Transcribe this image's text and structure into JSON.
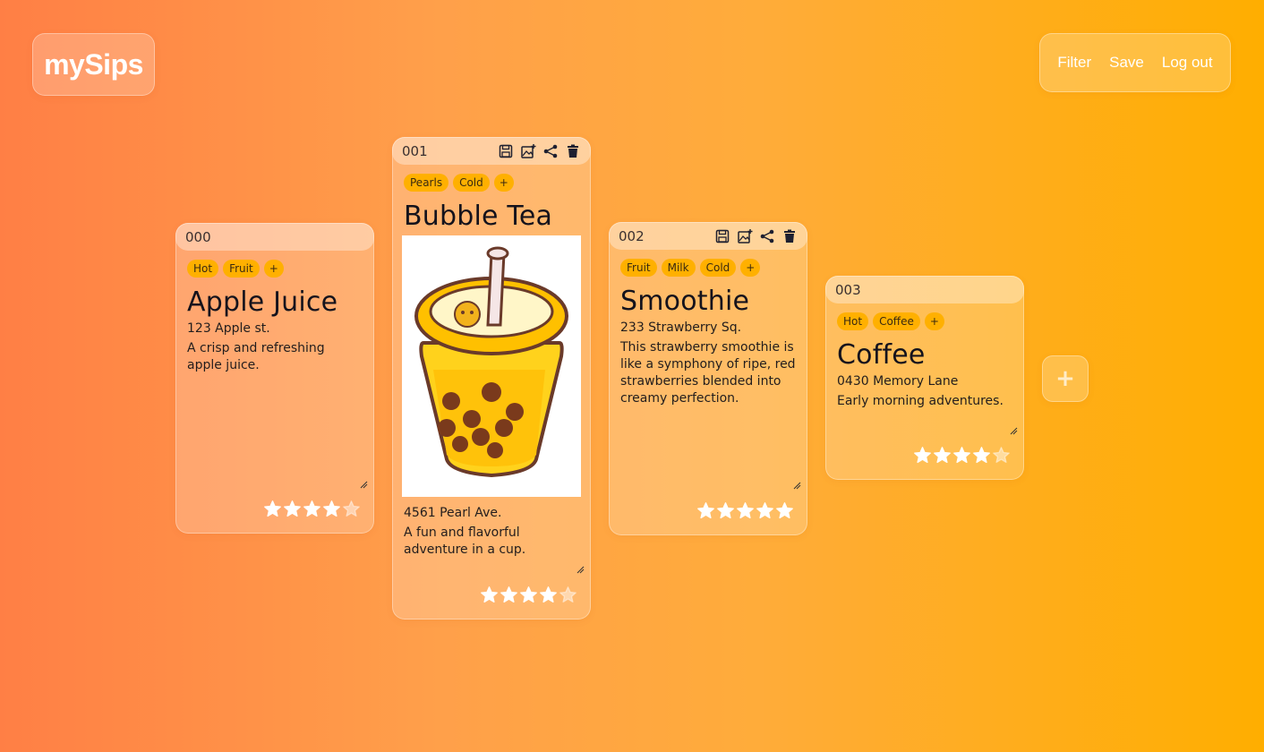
{
  "app": {
    "logo": "mySips"
  },
  "nav": {
    "filter": "Filter",
    "save": "Save",
    "logout": "Log out"
  },
  "add_button": "+",
  "cards": [
    {
      "id": "000",
      "tags": [
        "Hot",
        "Fruit"
      ],
      "add_tag": "+",
      "title": "Apple Juice",
      "address": "123 Apple st.",
      "description": "A crisp and refreshing apple juice.",
      "rating": 4,
      "max_rating": 5,
      "show_actions": false
    },
    {
      "id": "001",
      "tags": [
        "Pearls",
        "Cold"
      ],
      "add_tag": "+",
      "title": "Bubble Tea",
      "address": "4561 Pearl Ave.",
      "description": "A fun and flavorful adventure in a cup.",
      "rating": 4,
      "max_rating": 5,
      "show_actions": true
    },
    {
      "id": "002",
      "tags": [
        "Fruit",
        "Milk",
        "Cold"
      ],
      "add_tag": "+",
      "title": "Smoothie",
      "address": "233 Strawberry Sq.",
      "description": "This strawberry smoothie is like a symphony of ripe, red strawberries blended into creamy perfection.",
      "rating": 5,
      "max_rating": 5,
      "show_actions": true
    },
    {
      "id": "003",
      "tags": [
        "Hot",
        "Coffee"
      ],
      "add_tag": "+",
      "title": "Coffee",
      "address": "0430 Memory Lane",
      "description": "Early morning adventures.",
      "rating": 4,
      "max_rating": 5,
      "show_actions": false
    }
  ],
  "icons": [
    "save-icon",
    "add-image-icon",
    "share-icon",
    "trash-icon",
    "star-icon",
    "plus-icon"
  ]
}
